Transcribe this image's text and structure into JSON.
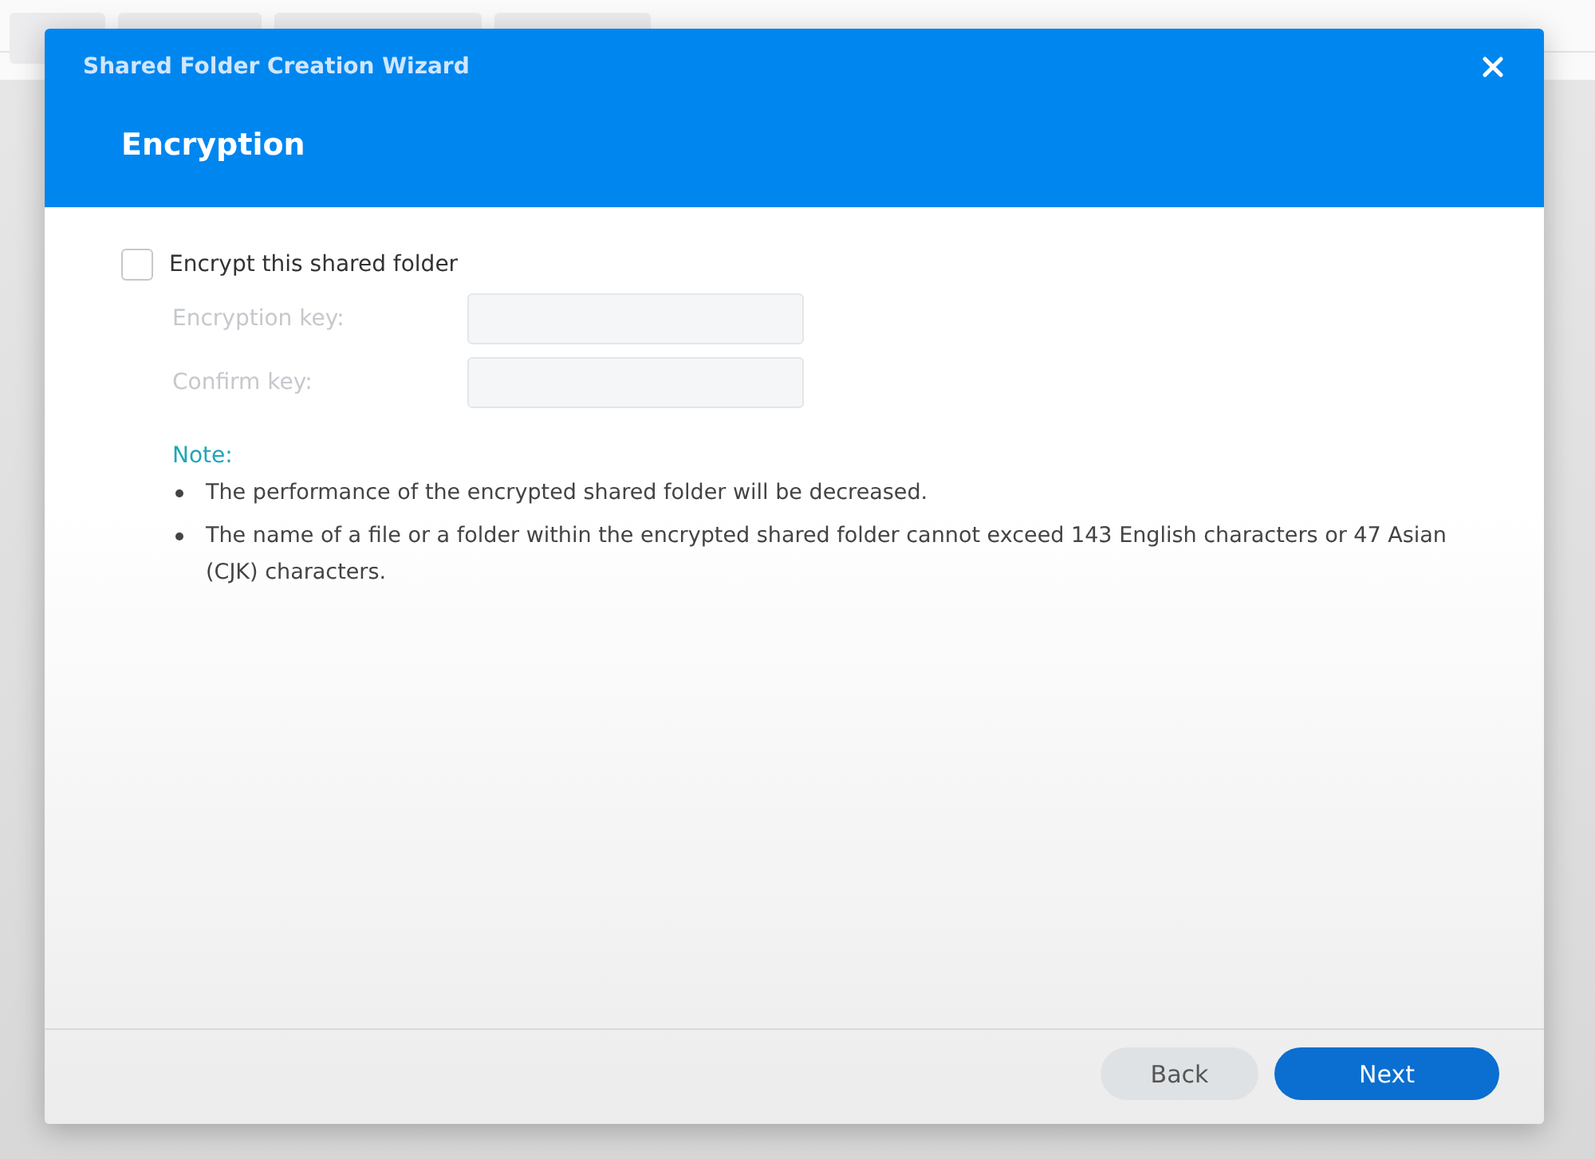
{
  "dialog": {
    "title": "Shared Folder Creation Wizard",
    "step_title": "Encryption"
  },
  "encrypt": {
    "label": "Encrypt this shared folder",
    "checked": false
  },
  "fields": [
    {
      "label": "Encryption key:",
      "disabled": true
    },
    {
      "label": "Confirm key:",
      "disabled": true
    }
  ],
  "note": {
    "heading": "Note:",
    "items": [
      "The performance of the encrypted shared folder will be decreased.",
      "The name of a file or a folder within the encrypted shared folder cannot exceed 143 English characters or 47 Asian (CJK) characters."
    ]
  },
  "buttons": [
    {
      "label": "Back",
      "kind": "secondary"
    },
    {
      "label": "Next",
      "kind": "primary"
    }
  ]
}
